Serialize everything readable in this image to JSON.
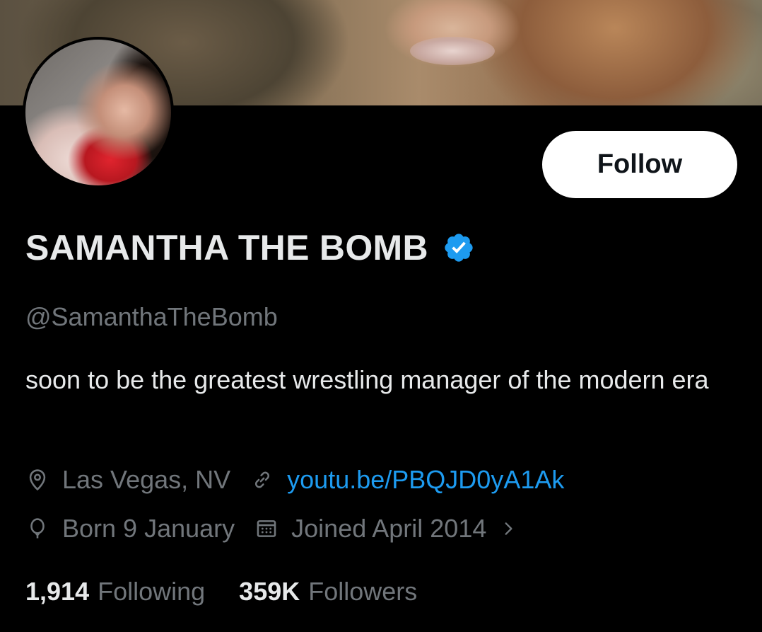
{
  "profile": {
    "display_name": "SAMANTHA THE BOMB",
    "handle": "@SamanthaTheBomb",
    "bio": "soon to be the greatest wrestling manager of the modern era",
    "verified": true,
    "follow_label": "Follow"
  },
  "meta": {
    "location": "Las Vegas, NV",
    "website": "youtu.be/PBQJD0yA1Ak",
    "birthday": "Born 9 January",
    "joined": "Joined April 2014"
  },
  "stats": {
    "following_count": "1,914",
    "following_label": "Following",
    "followers_count": "359K",
    "followers_label": "Followers"
  },
  "icons": {
    "verified": "verified-badge-icon",
    "location": "location-pin-icon",
    "website": "link-icon",
    "birthday": "balloon-icon",
    "joined": "calendar-icon",
    "expand": "chevron-right-icon"
  },
  "colors": {
    "background": "#000000",
    "accent": "#1d9bf0",
    "primary_text": "#e7e9ea",
    "secondary_text": "#71767b",
    "button_bg": "#ffffff"
  }
}
